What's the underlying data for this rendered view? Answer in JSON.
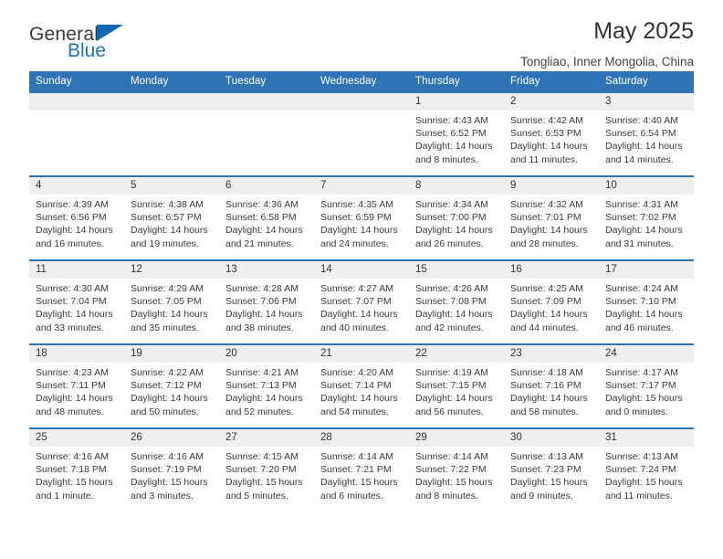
{
  "brand": {
    "line1": "General",
    "line2": "Blue",
    "accent_color": "#1b75bb"
  },
  "header": {
    "title": "May 2025",
    "subtitle": "Tongliao, Inner Mongolia, China"
  },
  "calendar": {
    "header_color": "#2e74b5",
    "daynum_band_color": "#efefef",
    "weekday_headers": [
      "Sunday",
      "Monday",
      "Tuesday",
      "Wednesday",
      "Thursday",
      "Friday",
      "Saturday"
    ],
    "weeks": [
      [
        {
          "day": "",
          "sunrise": "",
          "sunset": "",
          "daylight": ""
        },
        {
          "day": "",
          "sunrise": "",
          "sunset": "",
          "daylight": ""
        },
        {
          "day": "",
          "sunrise": "",
          "sunset": "",
          "daylight": ""
        },
        {
          "day": "",
          "sunrise": "",
          "sunset": "",
          "daylight": ""
        },
        {
          "day": "1",
          "sunrise": "Sunrise: 4:43 AM",
          "sunset": "Sunset: 6:52 PM",
          "daylight": "Daylight: 14 hours and 8 minutes."
        },
        {
          "day": "2",
          "sunrise": "Sunrise: 4:42 AM",
          "sunset": "Sunset: 6:53 PM",
          "daylight": "Daylight: 14 hours and 11 minutes."
        },
        {
          "day": "3",
          "sunrise": "Sunrise: 4:40 AM",
          "sunset": "Sunset: 6:54 PM",
          "daylight": "Daylight: 14 hours and 14 minutes."
        }
      ],
      [
        {
          "day": "4",
          "sunrise": "Sunrise: 4:39 AM",
          "sunset": "Sunset: 6:56 PM",
          "daylight": "Daylight: 14 hours and 16 minutes."
        },
        {
          "day": "5",
          "sunrise": "Sunrise: 4:38 AM",
          "sunset": "Sunset: 6:57 PM",
          "daylight": "Daylight: 14 hours and 19 minutes."
        },
        {
          "day": "6",
          "sunrise": "Sunrise: 4:36 AM",
          "sunset": "Sunset: 6:58 PM",
          "daylight": "Daylight: 14 hours and 21 minutes."
        },
        {
          "day": "7",
          "sunrise": "Sunrise: 4:35 AM",
          "sunset": "Sunset: 6:59 PM",
          "daylight": "Daylight: 14 hours and 24 minutes."
        },
        {
          "day": "8",
          "sunrise": "Sunrise: 4:34 AM",
          "sunset": "Sunset: 7:00 PM",
          "daylight": "Daylight: 14 hours and 26 minutes."
        },
        {
          "day": "9",
          "sunrise": "Sunrise: 4:32 AM",
          "sunset": "Sunset: 7:01 PM",
          "daylight": "Daylight: 14 hours and 28 minutes."
        },
        {
          "day": "10",
          "sunrise": "Sunrise: 4:31 AM",
          "sunset": "Sunset: 7:02 PM",
          "daylight": "Daylight: 14 hours and 31 minutes."
        }
      ],
      [
        {
          "day": "11",
          "sunrise": "Sunrise: 4:30 AM",
          "sunset": "Sunset: 7:04 PM",
          "daylight": "Daylight: 14 hours and 33 minutes."
        },
        {
          "day": "12",
          "sunrise": "Sunrise: 4:29 AM",
          "sunset": "Sunset: 7:05 PM",
          "daylight": "Daylight: 14 hours and 35 minutes."
        },
        {
          "day": "13",
          "sunrise": "Sunrise: 4:28 AM",
          "sunset": "Sunset: 7:06 PM",
          "daylight": "Daylight: 14 hours and 38 minutes."
        },
        {
          "day": "14",
          "sunrise": "Sunrise: 4:27 AM",
          "sunset": "Sunset: 7:07 PM",
          "daylight": "Daylight: 14 hours and 40 minutes."
        },
        {
          "day": "15",
          "sunrise": "Sunrise: 4:26 AM",
          "sunset": "Sunset: 7:08 PM",
          "daylight": "Daylight: 14 hours and 42 minutes."
        },
        {
          "day": "16",
          "sunrise": "Sunrise: 4:25 AM",
          "sunset": "Sunset: 7:09 PM",
          "daylight": "Daylight: 14 hours and 44 minutes."
        },
        {
          "day": "17",
          "sunrise": "Sunrise: 4:24 AM",
          "sunset": "Sunset: 7:10 PM",
          "daylight": "Daylight: 14 hours and 46 minutes."
        }
      ],
      [
        {
          "day": "18",
          "sunrise": "Sunrise: 4:23 AM",
          "sunset": "Sunset: 7:11 PM",
          "daylight": "Daylight: 14 hours and 48 minutes."
        },
        {
          "day": "19",
          "sunrise": "Sunrise: 4:22 AM",
          "sunset": "Sunset: 7:12 PM",
          "daylight": "Daylight: 14 hours and 50 minutes."
        },
        {
          "day": "20",
          "sunrise": "Sunrise: 4:21 AM",
          "sunset": "Sunset: 7:13 PM",
          "daylight": "Daylight: 14 hours and 52 minutes."
        },
        {
          "day": "21",
          "sunrise": "Sunrise: 4:20 AM",
          "sunset": "Sunset: 7:14 PM",
          "daylight": "Daylight: 14 hours and 54 minutes."
        },
        {
          "day": "22",
          "sunrise": "Sunrise: 4:19 AM",
          "sunset": "Sunset: 7:15 PM",
          "daylight": "Daylight: 14 hours and 56 minutes."
        },
        {
          "day": "23",
          "sunrise": "Sunrise: 4:18 AM",
          "sunset": "Sunset: 7:16 PM",
          "daylight": "Daylight: 14 hours and 58 minutes."
        },
        {
          "day": "24",
          "sunrise": "Sunrise: 4:17 AM",
          "sunset": "Sunset: 7:17 PM",
          "daylight": "Daylight: 15 hours and 0 minutes."
        }
      ],
      [
        {
          "day": "25",
          "sunrise": "Sunrise: 4:16 AM",
          "sunset": "Sunset: 7:18 PM",
          "daylight": "Daylight: 15 hours and 1 minute."
        },
        {
          "day": "26",
          "sunrise": "Sunrise: 4:16 AM",
          "sunset": "Sunset: 7:19 PM",
          "daylight": "Daylight: 15 hours and 3 minutes."
        },
        {
          "day": "27",
          "sunrise": "Sunrise: 4:15 AM",
          "sunset": "Sunset: 7:20 PM",
          "daylight": "Daylight: 15 hours and 5 minutes."
        },
        {
          "day": "28",
          "sunrise": "Sunrise: 4:14 AM",
          "sunset": "Sunset: 7:21 PM",
          "daylight": "Daylight: 15 hours and 6 minutes."
        },
        {
          "day": "29",
          "sunrise": "Sunrise: 4:14 AM",
          "sunset": "Sunset: 7:22 PM",
          "daylight": "Daylight: 15 hours and 8 minutes."
        },
        {
          "day": "30",
          "sunrise": "Sunrise: 4:13 AM",
          "sunset": "Sunset: 7:23 PM",
          "daylight": "Daylight: 15 hours and 9 minutes."
        },
        {
          "day": "31",
          "sunrise": "Sunrise: 4:13 AM",
          "sunset": "Sunset: 7:24 PM",
          "daylight": "Daylight: 15 hours and 11 minutes."
        }
      ]
    ]
  }
}
